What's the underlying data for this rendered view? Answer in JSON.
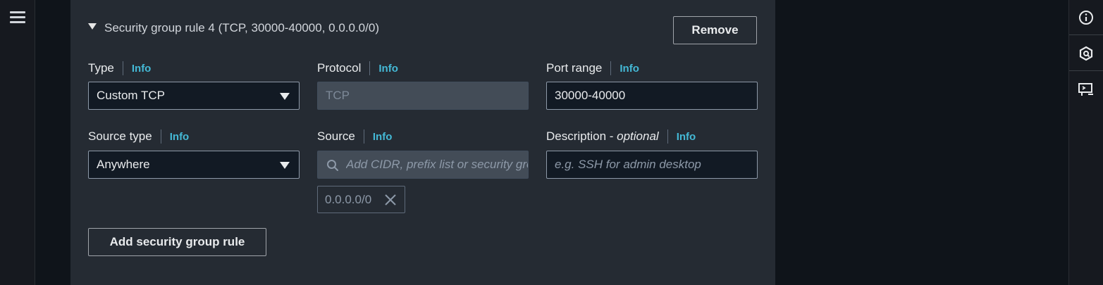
{
  "nav": {
    "menu_icon": "hamburger-menu-icon"
  },
  "rule": {
    "title": "Security group rule 4 (TCP, 30000-40000, 0.0.0.0/0)",
    "remove_label": "Remove"
  },
  "fields": {
    "type": {
      "label": "Type",
      "info": "Info",
      "value": "Custom TCP"
    },
    "protocol": {
      "label": "Protocol",
      "info": "Info",
      "value": "TCP"
    },
    "port_range": {
      "label": "Port range",
      "info": "Info",
      "value": "30000-40000"
    },
    "source_type": {
      "label": "Source type",
      "info": "Info",
      "value": "Anywhere"
    },
    "source": {
      "label": "Source",
      "info": "Info",
      "placeholder": "Add CIDR, prefix list or security group",
      "token": "0.0.0.0/0"
    },
    "description": {
      "label": "Description - ",
      "optional": "optional",
      "info": "Info",
      "placeholder": "e.g. SSH for admin desktop"
    }
  },
  "add_rule_label": "Add security group rule",
  "right_rail": {
    "icons": [
      "info-icon",
      "shield-icon",
      "feedback-icon"
    ]
  },
  "colors": {
    "accent": "#44b9d6",
    "panel": "#252b33",
    "background": "#0f141a"
  }
}
